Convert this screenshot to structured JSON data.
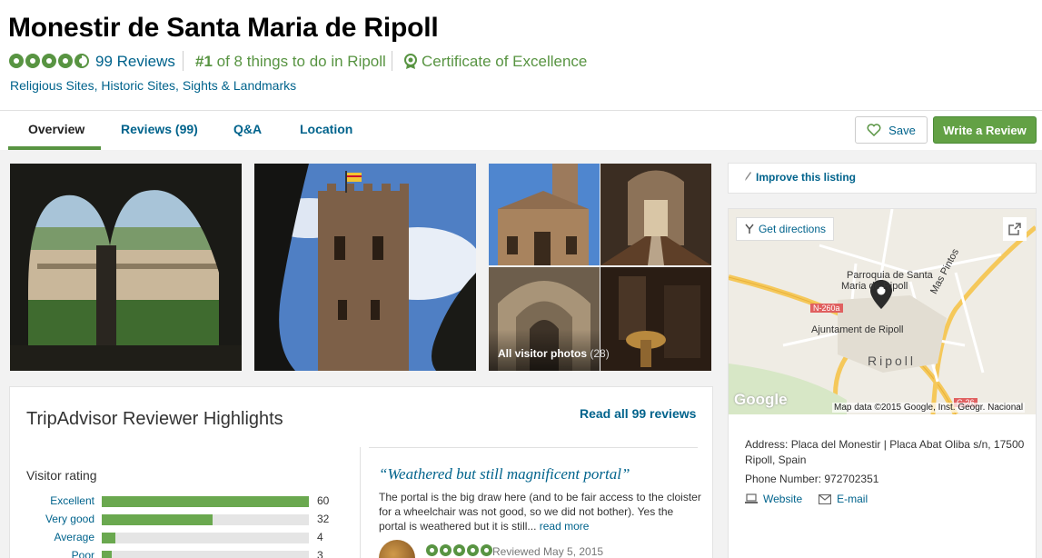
{
  "header": {
    "title": "Monestir de Santa Maria de Ripoll",
    "rating_bubbles": 4.5,
    "reviews_link": "99 Reviews",
    "rank_prefix": "#1",
    "rank_text": " of 8 things to do in Ripoll",
    "certificate": "Certificate of Excellence",
    "categories": "Religious Sites, Historic Sites, Sights & Landmarks"
  },
  "tabs": [
    {
      "label": "Overview",
      "active": true
    },
    {
      "label": "Reviews (99)",
      "active": false
    },
    {
      "label": "Q&A",
      "active": false
    },
    {
      "label": "Location",
      "active": false
    }
  ],
  "actions": {
    "save_label": "Save",
    "write_review_label": "Write a Review"
  },
  "photos": {
    "all_photos_label": "All visitor photos",
    "all_photos_count": "(28)"
  },
  "highlights": {
    "title": "TripAdvisor Reviewer Highlights",
    "read_all": "Read all 99 reviews",
    "visitor_rating_label": "Visitor rating",
    "ratings": [
      {
        "label": "Excellent",
        "count": 60
      },
      {
        "label": "Very good",
        "count": 32
      },
      {
        "label": "Average",
        "count": 4
      },
      {
        "label": "Poor",
        "count": 3
      }
    ],
    "review": {
      "quote": "“Weathered but still magnificent portal”",
      "body": "The portal is the big draw here (and to be fair access to the cloister for a wheelchair was not good, so we did not bother). Yes the portal is weathered but it is still...",
      "read_more": "read more",
      "rating_bubbles": 5,
      "reviewed_date": "Reviewed May 5, 2015"
    }
  },
  "sidebar": {
    "improve_listing": "Improve this listing",
    "map": {
      "get_directions": "Get directions",
      "label_parroquia_1": "Parroquia de Santa",
      "label_parroquia_2": "Maria de Ripoll",
      "label_ajuntament": "Ajuntament de Ripoll",
      "label_ripoll": "Ripoll",
      "label_mas_pintos": "Mas Pintos",
      "road_n260a": "N-260a",
      "road_c26": "C-26",
      "google": "Google",
      "map_data": "Map data ©2015 Google, Inst. Geogr. Nacional"
    },
    "address": "Address: Placa del Monestir | Placa Abat Oliba s/n, 17500 Ripoll, Spain",
    "phone": "Phone Number: 972702351",
    "website": "Website",
    "email": "E-mail"
  },
  "colors": {
    "accent_green": "#589442",
    "link_blue": "#00638c",
    "write_button": "#63a145"
  }
}
